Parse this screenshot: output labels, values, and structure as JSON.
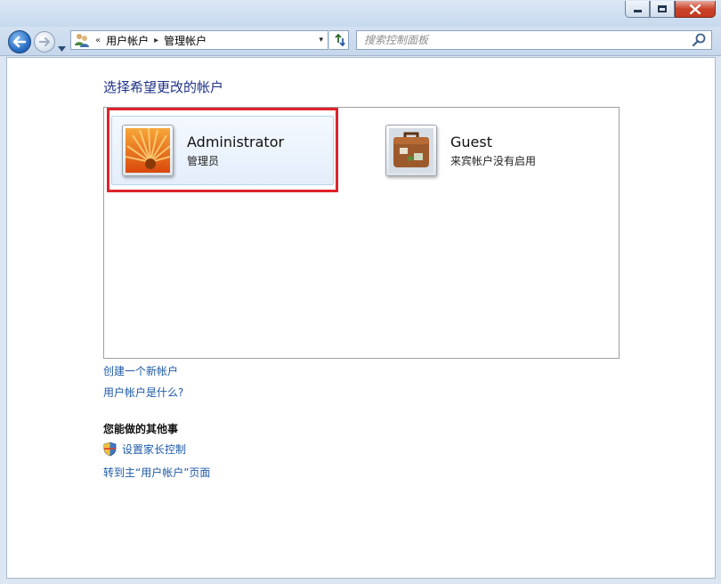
{
  "window": {
    "buttons": {
      "minimize": "minimize",
      "maximize": "maximize",
      "close": "×"
    }
  },
  "nav": {
    "overflow_chevron": "«",
    "breadcrumb": [
      "用户帐户",
      "管理帐户"
    ],
    "separator": "▸",
    "dropdown": "▾",
    "search_placeholder": "搜索控制面板",
    "icons": {
      "back": "back-arrow-icon",
      "forward": "forward-arrow-icon",
      "history": "chevron-down-icon",
      "location": "user-accounts-icon",
      "refresh": "refresh-icon",
      "search": "search-icon"
    }
  },
  "main": {
    "heading": "选择希望更改的帐户",
    "accounts": [
      {
        "name": "Administrator",
        "role": "管理员",
        "picture": "orange-flower-picture"
      },
      {
        "name": "Guest",
        "role": "来宾帐户没有启用",
        "picture": "suitcase-picture"
      }
    ],
    "links": {
      "create_account": "创建一个新帐户",
      "what_is_account": "用户帐户是什么?"
    },
    "other_heading": "您能做的其他事",
    "other_links": {
      "parental_control": "设置家长控制",
      "goto_main": "转到主“用户帐户”页面"
    }
  },
  "colors": {
    "link": "#1e5aa6",
    "heading": "#1e3287",
    "highlight_border": "#e0232b",
    "close_button": "#c8442b"
  }
}
